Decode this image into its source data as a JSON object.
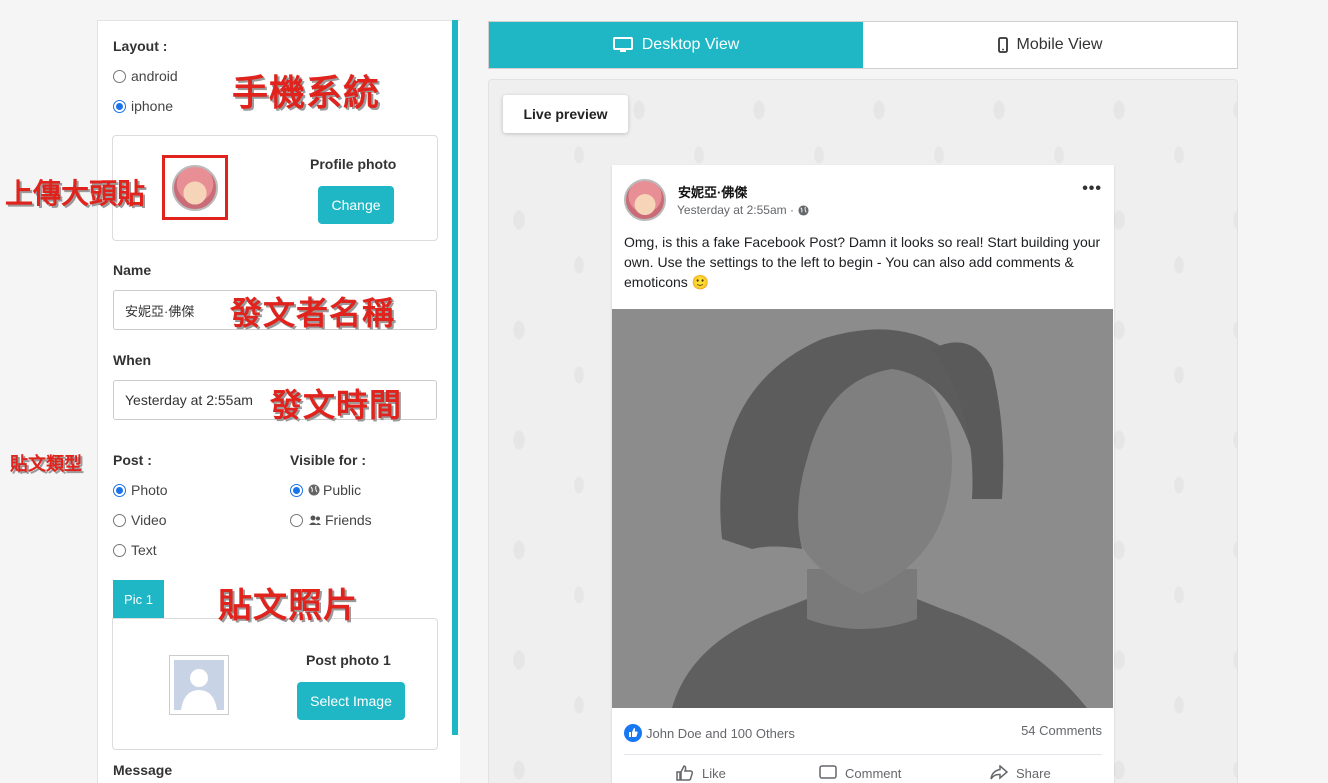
{
  "settings": {
    "layout_label": "Layout :",
    "layout_options": [
      "android",
      "iphone"
    ],
    "layout_selected": "iphone",
    "profile_photo_label": "Profile photo",
    "change_button": "Change",
    "name_label": "Name",
    "name_value": "安妮亞·佛傑",
    "when_label": "When",
    "when_value": "Yesterday at 2:55am",
    "post_label": "Post :",
    "post_options": [
      "Photo",
      "Video",
      "Text"
    ],
    "post_selected": "Photo",
    "visible_label": "Visible for :",
    "visible_options": [
      "Public",
      "Friends"
    ],
    "visible_selected": "Public",
    "pic_tab": "Pic 1",
    "post_photo_label": "Post photo 1",
    "select_image_button": "Select Image",
    "message_label": "Message"
  },
  "annotations": {
    "phone_system": "手機系統",
    "upload_avatar": "上傳大頭貼",
    "poster_name": "發文者名稱",
    "post_time": "發文時間",
    "post_type": "貼文類型",
    "post_photo": "貼文照片",
    "color": "#e0231d"
  },
  "preview": {
    "tabs": [
      "Desktop View",
      "Mobile View"
    ],
    "active_tab": "Desktop View",
    "live_preview": "Live preview",
    "post": {
      "author": "安妮亞·佛傑",
      "time": "Yesterday at 2:55am ·",
      "text": "Omg, is this a fake Facebook Post? Damn it looks so real! Start building your own. Use the settings to the left to begin - You can also add comments & emoticons 🙂",
      "reactions": "John Doe and 100 Others",
      "comments": "54 Comments",
      "actions": [
        "Like",
        "Comment",
        "Share"
      ],
      "more": "•••"
    }
  },
  "colors": {
    "accent": "#1fb7c6",
    "radio": "#1a73e8",
    "like_blue": "#1877f2"
  }
}
